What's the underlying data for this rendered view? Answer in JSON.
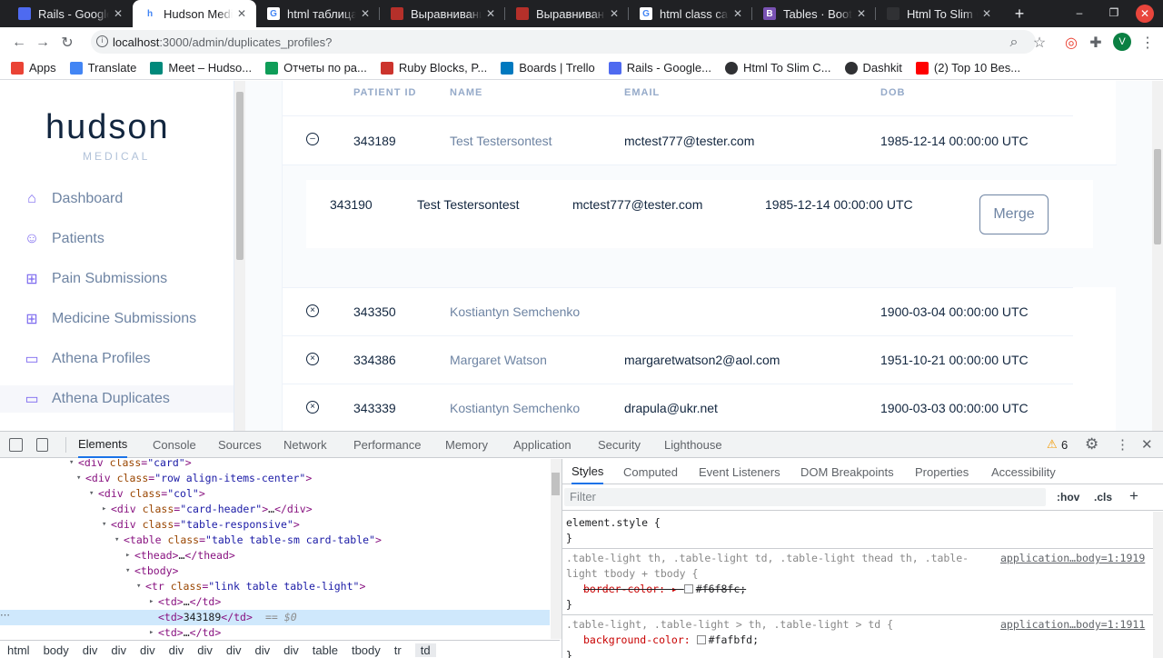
{
  "tabs": [
    {
      "title": "Rails - Google",
      "favicon_color": "#4e6af0",
      "favicon_text": ""
    },
    {
      "title": "Hudson Medica",
      "favicon_color": "#ffffff",
      "favicon_text": "h",
      "active": true
    },
    {
      "title": "html таблица",
      "favicon_color": "#ffffff",
      "favicon_text": "G"
    },
    {
      "title": "Выравнивание",
      "favicon_color": "#b5302a",
      "favicon_text": ""
    },
    {
      "title": "Выравнивание",
      "favicon_color": "#b5302a",
      "favicon_text": ""
    },
    {
      "title": "html class card",
      "favicon_color": "#ffffff",
      "favicon_text": "G"
    },
    {
      "title": "Tables · Bootst",
      "favicon_color": "#7952b3",
      "favicon_text": "B"
    },
    {
      "title": "Html To Slim C",
      "favicon_color": "#303134",
      "favicon_text": ""
    }
  ],
  "url": {
    "host": "localhost",
    "path": ":3000/admin/duplicates_profiles?"
  },
  "profile_initial": "V",
  "bookmarks": [
    {
      "label": "Apps",
      "color": "#ea4335"
    },
    {
      "label": "Translate",
      "color": "#4285f4"
    },
    {
      "label": "Meet – Hudso...",
      "color": "#00897b"
    },
    {
      "label": "Отчеты по ра...",
      "color": "#0f9d58"
    },
    {
      "label": "Ruby Blocks, P...",
      "color": "#cc342d"
    },
    {
      "label": "Boards | Trello",
      "color": "#0079bf"
    },
    {
      "label": "Rails - Google...",
      "color": "#4e6af0"
    },
    {
      "label": "Html To Slim C...",
      "color": "#303134"
    },
    {
      "label": "Dashkit",
      "color": "#303134"
    },
    {
      "label": "(2) Top 10 Bes...",
      "color": "#ff0000"
    }
  ],
  "brand": {
    "name": "hudson",
    "sub": "MEDICAL",
    "accent": "#7c69ef"
  },
  "sidebar": {
    "items": [
      {
        "label": "Dashboard",
        "icon": "home-icon"
      },
      {
        "label": "Patients",
        "icon": "users-icon"
      },
      {
        "label": "Pain Submissions",
        "icon": "file-plus-icon"
      },
      {
        "label": "Medicine Submissions",
        "icon": "plus-square-icon"
      },
      {
        "label": "Athena Profiles",
        "icon": "folder-icon"
      },
      {
        "label": "Athena Duplicates",
        "icon": "folder-icon",
        "selected": true
      }
    ]
  },
  "table": {
    "headers": [
      "PATIENT ID",
      "NAME",
      "EMAIL",
      "DOB"
    ],
    "expanded_row": {
      "id": "343189",
      "name": "Test Testersontest",
      "email": "mctest777@tester.com",
      "dob": "1985-12-14 00:00:00 UTC"
    },
    "duplicate": {
      "id": "343190",
      "name": "Test Testersontest",
      "email": "mctest777@tester.com",
      "dob": "1985-12-14 00:00:00 UTC",
      "action": "Merge"
    },
    "rows": [
      {
        "id": "343350",
        "name": "Kostiantyn Semchenko",
        "email": "",
        "dob": "1900-03-04 00:00:00 UTC"
      },
      {
        "id": "334386",
        "name": "Margaret Watson",
        "email": "margaretwatson2@aol.com",
        "dob": "1951-10-21 00:00:00 UTC"
      },
      {
        "id": "343339",
        "name": "Kostiantyn Semchenko",
        "email": "drapula@ukr.net",
        "dob": "1900-03-03 00:00:00 UTC"
      }
    ]
  },
  "devtools": {
    "tabs": [
      "Elements",
      "Console",
      "Sources",
      "Network",
      "Performance",
      "Memory",
      "Application",
      "Security",
      "Lighthouse"
    ],
    "warnings": "6",
    "elements": [
      {
        "indent": 86,
        "arrow": "▾",
        "html": "<div class=\"card\">"
      },
      {
        "indent": 94,
        "arrow": "▾",
        "html": "<div class=\"row align-items-center\">"
      },
      {
        "indent": 108,
        "arrow": "▾",
        "html": "<div class=\"col\">"
      },
      {
        "indent": 122,
        "arrow": "▸",
        "html": "<div class=\"card-header\">…</div>"
      },
      {
        "indent": 122,
        "arrow": "▾",
        "html": "<div class=\"table-responsive\">"
      },
      {
        "indent": 136,
        "arrow": "▾",
        "html": "<table class=\"table table-sm card-table\">"
      },
      {
        "indent": 148,
        "arrow": "▸",
        "html": "<thead>…</thead>"
      },
      {
        "indent": 148,
        "arrow": "▾",
        "html": "<tbody>"
      },
      {
        "indent": 160,
        "arrow": "▾",
        "html": "<tr class=\"link table table-light\">"
      },
      {
        "indent": 174,
        "arrow": "▸",
        "html": "<td>…</td>"
      },
      {
        "indent": 174,
        "arrow": "",
        "html": "<td>343189</td>",
        "suffix": "== $0",
        "hl": true
      },
      {
        "indent": 174,
        "arrow": "▸",
        "html": "<td>…</td>"
      }
    ],
    "breadcrumbs": [
      "html",
      "body",
      "div",
      "div",
      "div",
      "div",
      "div",
      "div",
      "div",
      "div",
      "table",
      "tbody",
      "tr",
      "td"
    ],
    "style_tabs": [
      "Styles",
      "Computed",
      "Event Listeners",
      "DOM Breakpoints",
      "Properties",
      "Accessibility"
    ],
    "filter_placeholder": "Filter",
    "hov": ":hov",
    "cls": ".cls",
    "rules": {
      "r0": "element.style {",
      "r0c": "}",
      "r1a": ".table-light th, .table-light td, .table-light thead th, .table-",
      "r1b": "light tbody + tbody {",
      "r1src": "application…body=1:1919",
      "r1prop": "border-color: ▸ ",
      "r1val": "#f6f8fc;",
      "r1c": "}",
      "r2a": ".table-light, .table-light > th, .table-light > td {",
      "r2src": "application…body=1:1911",
      "r2prop": "background-color: ",
      "r2val": "#fafbfd;",
      "r2c": "}"
    }
  }
}
